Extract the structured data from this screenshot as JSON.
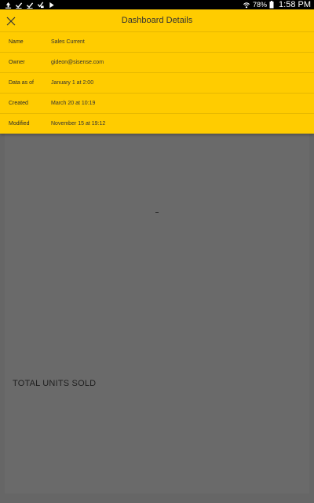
{
  "status_bar": {
    "left_icons": [
      "upload-icon",
      "check-icon",
      "check-icon",
      "check-flag-icon",
      "play-flag-icon"
    ],
    "right_icons": [
      "wifi-icon",
      "battery-icon"
    ],
    "battery_percent": "78%",
    "clock": "1:58 PM"
  },
  "details": {
    "title": "Dashboard Details",
    "close_icon": "close-icon",
    "rows": [
      {
        "label": "Name",
        "value": "Sales Current"
      },
      {
        "label": "Owner",
        "value": "gideon@sisense.com"
      },
      {
        "label": "Data as of",
        "value": "January 1 at 2:00"
      },
      {
        "label": "Created",
        "value": "March 20 at 10:19"
      },
      {
        "label": "Modified",
        "value": "November 15 at 19:12"
      }
    ]
  },
  "dashboard": {
    "widget_title": "TOTAL UNITS SOLD"
  },
  "colors": {
    "accent": "#ffcc00",
    "overlay": "#666666",
    "status_bar": "#000000"
  }
}
